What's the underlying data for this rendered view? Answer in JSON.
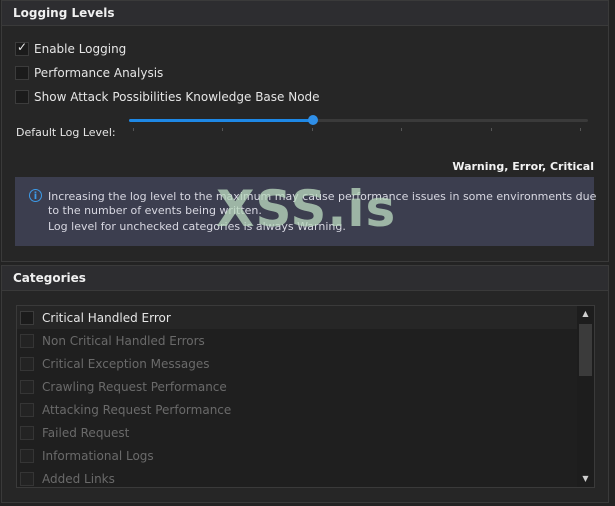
{
  "logging_panel": {
    "title": "Logging Levels",
    "enable_logging": {
      "label": "Enable Logging",
      "checked": true
    },
    "performance_analysis": {
      "label": "Performance Analysis",
      "checked": false
    },
    "attack_kb": {
      "label": "Show Attack Possibilities Knowledge Base Node",
      "checked": false
    },
    "default_log_level_label": "Default Log Level:",
    "slider": {
      "value_fraction": 0.4,
      "tick_count": 6
    },
    "level_text": "Warning, Error, Critical",
    "info": {
      "icon": "info-icon",
      "line1": "Increasing the log level to the maximum may cause performance issues in some environments due",
      "line2": "to the number of events being written.",
      "line3": "Log level for unchecked categories is always Warning."
    }
  },
  "watermark": "XSS.is",
  "categories_panel": {
    "title": "Categories",
    "items": [
      {
        "label": "Critical Handled Error",
        "enabled": true
      },
      {
        "label": "Non Critical Handled Errors",
        "enabled": false
      },
      {
        "label": "Critical Exception Messages",
        "enabled": false
      },
      {
        "label": "Crawling Request Performance",
        "enabled": false
      },
      {
        "label": "Attacking Request Performance",
        "enabled": false
      },
      {
        "label": "Failed Request",
        "enabled": false
      },
      {
        "label": "Informational Logs",
        "enabled": false
      },
      {
        "label": "Added Links",
        "enabled": false
      }
    ]
  },
  "colors": {
    "accent": "#2f8fe8",
    "info_bg": "#3c3e4f"
  }
}
